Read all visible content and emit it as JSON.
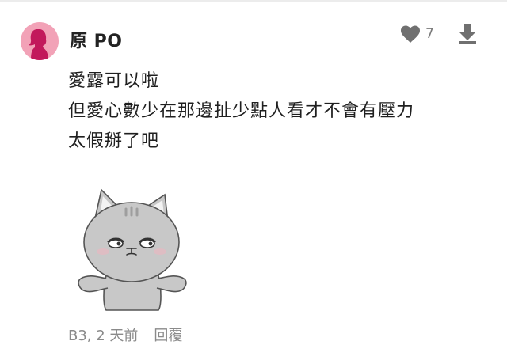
{
  "comment": {
    "author": "原 PO",
    "like_count": "7",
    "lines": [
      "愛露可以啦",
      "但愛心數少在那邊扯少點人看才不會有壓力",
      "太假掰了吧"
    ],
    "floor_time": "B3, 2 天前",
    "reply_label": "回覆"
  },
  "icons": {
    "avatar": "female-silhouette-avatar",
    "like": "heart-icon",
    "download": "arrow-down-icon",
    "sticker": "grumpy-cat-sticker"
  },
  "colors": {
    "avatar_bg": "#f2a2b7",
    "avatar_figure": "#c2185b",
    "icon_gray": "#707070",
    "meta_gray": "#8a8a8a"
  }
}
